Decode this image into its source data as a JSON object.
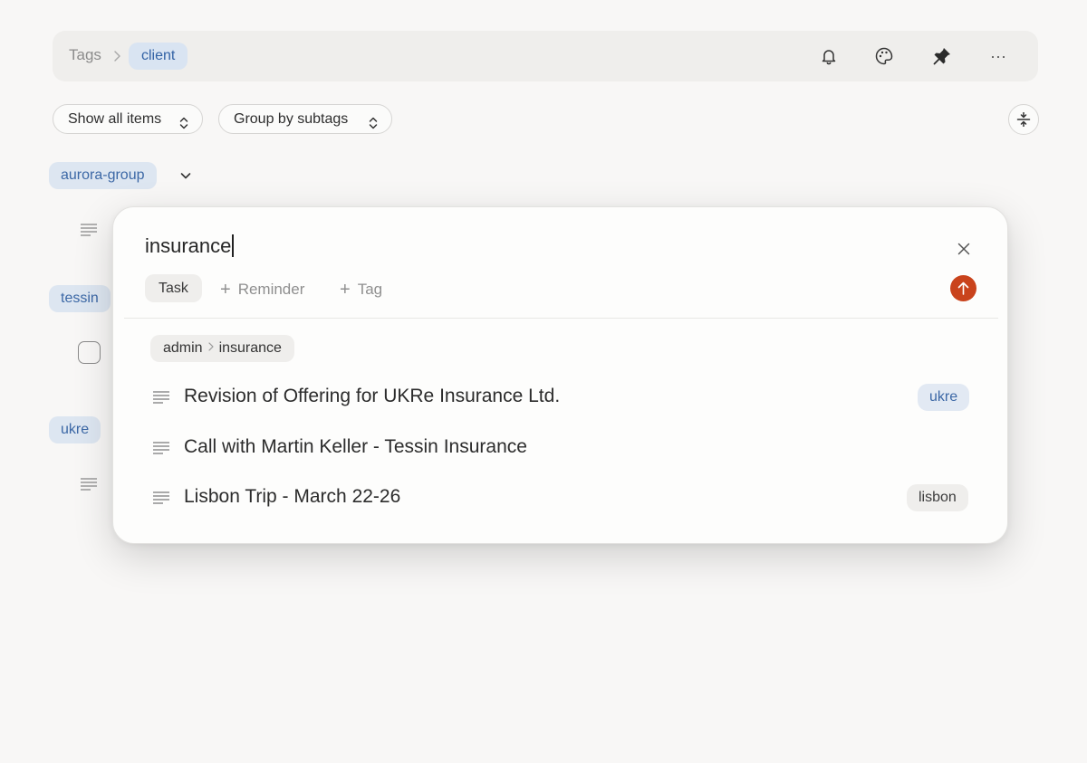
{
  "header": {
    "breadcrumb_root": "Tags",
    "breadcrumb_current": "client",
    "icons": [
      "bell-icon",
      "palette-icon",
      "pin-icon",
      "more-icon"
    ],
    "more_glyph": "···"
  },
  "filters": {
    "show_label": "Show all items",
    "group_label": "Group by subtags"
  },
  "groups": [
    {
      "tag": "aurora-group"
    },
    {
      "tag": "tessin"
    },
    {
      "tag": "ukre"
    }
  ],
  "modal": {
    "query": "insurance",
    "type_label": "Task",
    "add_reminder": "Reminder",
    "add_tag": "Tag",
    "path": {
      "parent": "admin",
      "child": "insurance"
    },
    "results": [
      {
        "title": "Revision of Offering for UKRe Insurance Ltd.",
        "tag": "ukre"
      },
      {
        "title": "Call with Martin Keller - Tessin Insurance",
        "tag": ""
      },
      {
        "title": "Lisbon Trip - March 22-26",
        "tag": "lisbon"
      }
    ]
  },
  "colors": {
    "accent": "#c9431c",
    "tag_blue_bg": "#dde6f1",
    "tag_blue_text": "#3c68a6"
  }
}
